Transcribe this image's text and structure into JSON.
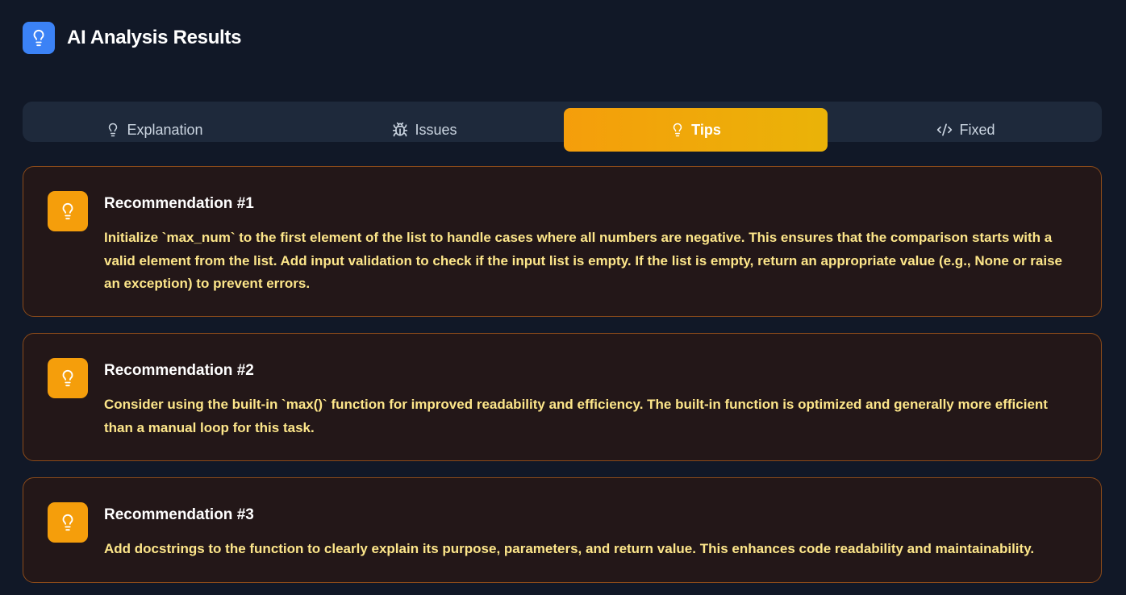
{
  "header": {
    "title": "AI Analysis Results",
    "icon": "lightbulb-icon",
    "icon_color": "#3b82f6"
  },
  "tabs": [
    {
      "label": "Explanation",
      "icon": "lightbulb-icon"
    },
    {
      "label": "Issues",
      "icon": "bug-icon"
    },
    {
      "label": "Tips",
      "icon": "lightbulb-icon",
      "active": true
    },
    {
      "label": "Fixed",
      "icon": "code-icon"
    }
  ],
  "accent_color": "#f59e0b",
  "recommendations": [
    {
      "title": "Recommendation #1",
      "text": "Initialize `max_num` to the first element of the list to handle cases where all numbers are negative. This ensures that the comparison starts with a valid element from the list. Add input validation to check if the input list is empty. If the list is empty, return an appropriate value (e.g., None or raise an exception) to prevent errors."
    },
    {
      "title": "Recommendation #2",
      "text": "Consider using the built-in `max()` function for improved readability and efficiency. The built-in function is optimized and generally more efficient than a manual loop for this task."
    },
    {
      "title": "Recommendation #3",
      "text": "Add docstrings to the function to clearly explain its purpose, parameters, and return value. This enhances code readability and maintainability."
    }
  ]
}
